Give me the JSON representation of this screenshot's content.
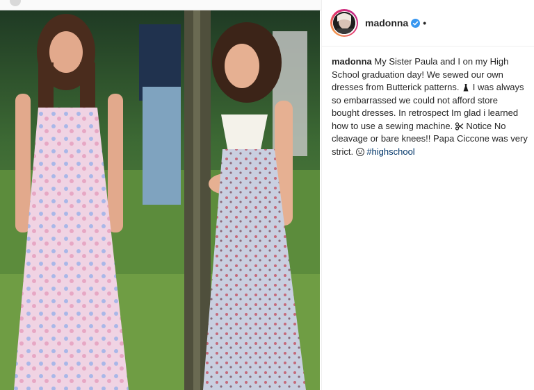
{
  "post": {
    "username": "madonna",
    "verified_icon": "verified-badge-icon",
    "more_indicator": "•",
    "caption": {
      "author": "madonna",
      "part1": "My Sister Paula and I on my High School graduation day! We sewed our own dresses from Butterick patterns.",
      "part2": "I was always so embarrassed we could not afford store bought dresses. In retrospect Im glad i learned how to use a sewing machine.",
      "part3": "Notice No cleavage or bare knees!! Papa Ciccone was very strict.",
      "hashtag": "#highschool"
    },
    "icons": [
      "dress-emoji-icon",
      "scissors-emoji-icon",
      "grin-emoji-icon"
    ]
  },
  "colors": {
    "link": "#003569",
    "text": "#262626",
    "verified": "#3897f0"
  }
}
